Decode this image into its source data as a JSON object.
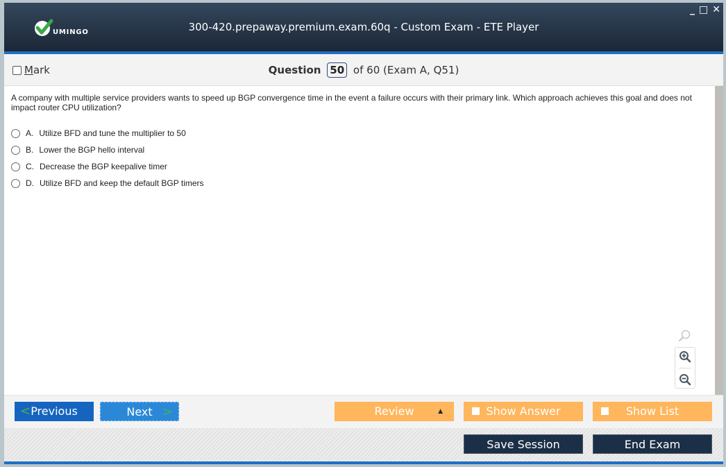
{
  "window": {
    "title": "300-420.prepaway.premium.exam.60q - Custom Exam - ETE Player",
    "logo_text": "UMINGO",
    "controls": {
      "minimize": "_",
      "maximize": "□",
      "close": "✕"
    }
  },
  "question_bar": {
    "mark_label_prefix": "M",
    "mark_label_rest": "ark",
    "question_word": "Question",
    "current": "50",
    "suffix": "of 60 (Exam A, Q51)"
  },
  "question": {
    "text": "A company with multiple service providers wants to speed up BGP convergence time in the event a failure occurs with their primary link. Which approach achieves this goal and does not impact router CPU utilization?",
    "options": [
      {
        "letter": "A.",
        "text": "Utilize BFD and tune the multiplier to 50"
      },
      {
        "letter": "B.",
        "text": "Lower the BGP hello interval"
      },
      {
        "letter": "C.",
        "text": "Decrease the BGP keepalive timer"
      },
      {
        "letter": "D.",
        "text": "Utilize BFD and keep the default BGP timers"
      }
    ]
  },
  "zoom_tools": {
    "search": "search-icon",
    "zoom_in": "zoom-in-icon",
    "zoom_out": "zoom-out-icon"
  },
  "nav": {
    "previous": "Previous",
    "next": "Next",
    "review": "Review",
    "show_answer": "Show Answer",
    "show_list": "Show List"
  },
  "footer": {
    "save_session": "Save Session",
    "end_exam": "End Exam"
  },
  "colors": {
    "title_bar": "#1b2737",
    "accent_blue": "#1f6ec3",
    "orange": "#ffb65c",
    "dark_button": "#1b2f47",
    "chevron_green": "#4caf50"
  }
}
